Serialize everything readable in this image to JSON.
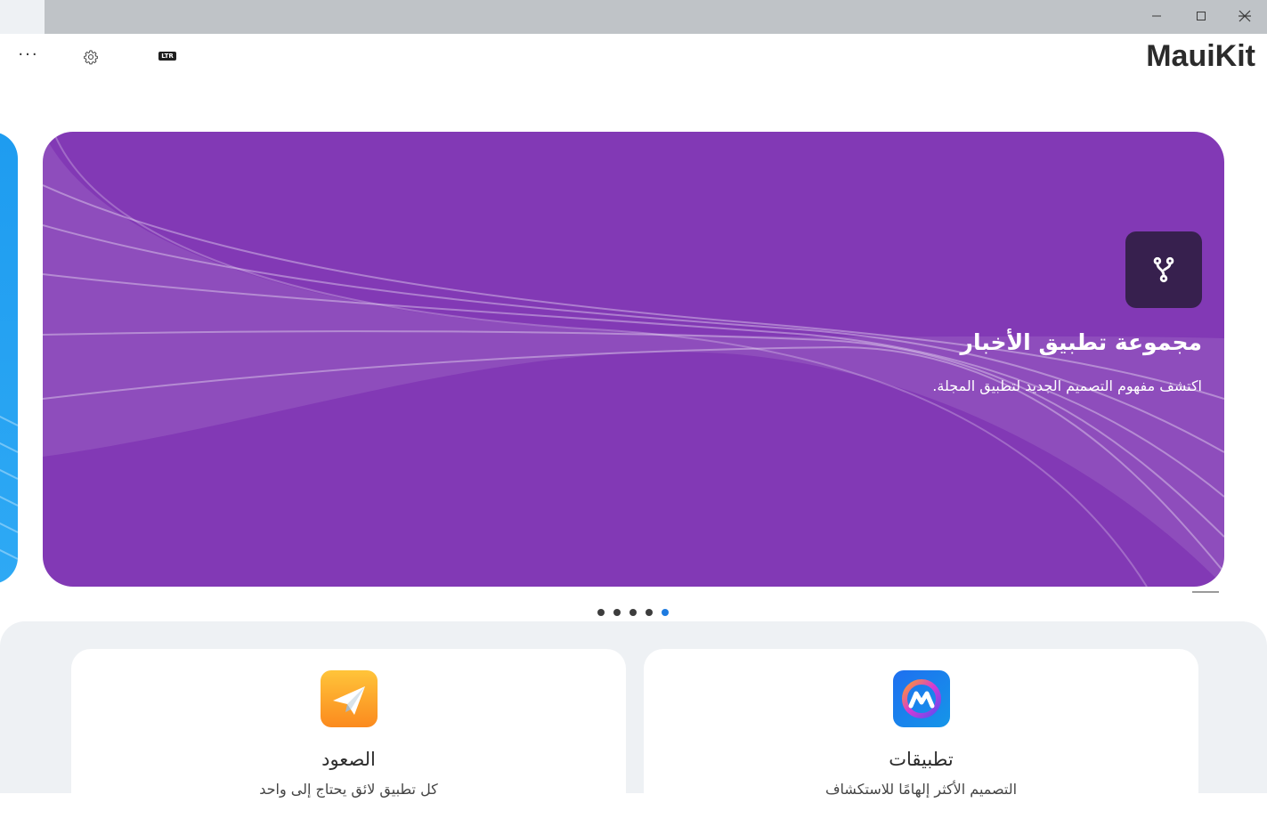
{
  "window": {
    "minimize_icon": "minimize-icon",
    "maximize_icon": "maximize-icon",
    "close_icon": "close-icon"
  },
  "toolbar": {
    "more_label": "···",
    "settings_icon": "gear-icon",
    "direction_toggle_label": "LTR",
    "brand": "MauiKit"
  },
  "carousel": {
    "current": {
      "icon": "fork-icon",
      "title": "مجموعة تطبيق الأخبار",
      "subtitle": "اكتشف مفهوم التصميم الجديد لتطبيق المجلة.",
      "background": "#8239b5",
      "icon_background": "#37204e"
    },
    "peek_color": "#1e9cf0",
    "page_count": 5,
    "active_page": 5,
    "active_dot_color": "#1e7be0"
  },
  "apps": [
    {
      "icon": "paper-plane-icon",
      "title": "الصعود",
      "description": "كل تطبيق لائق يحتاج إلى واحد"
    },
    {
      "icon": "maui-logo-icon",
      "title": "تطبيقات",
      "description": "التصميم الأكثر إلهامًا للاستكشاف"
    }
  ]
}
